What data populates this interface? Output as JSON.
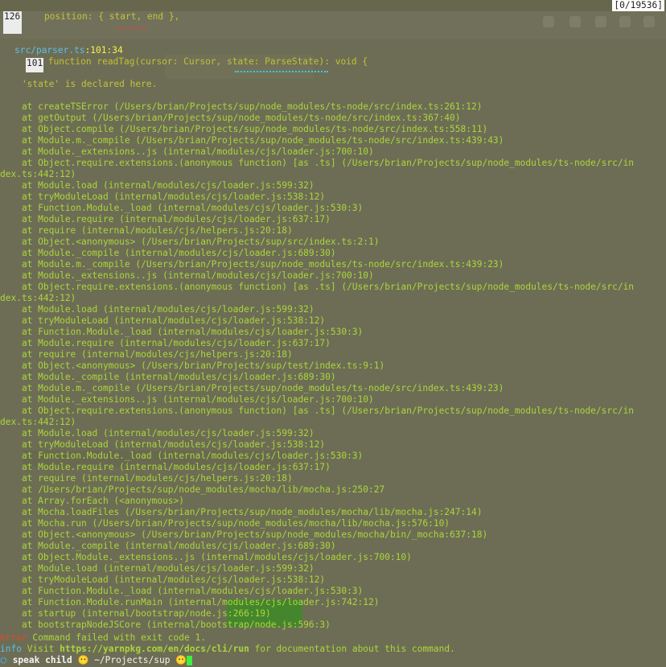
{
  "counter": "[0/19536]",
  "snippet": {
    "line1_num": "126",
    "line1_code": "    position: { start, end },",
    "file": "src/parser.ts",
    "file_pos": ":101:34",
    "line2_num": "101",
    "line2_code": " function readTag(cursor: Cursor, state: ParseState): void {",
    "note": "    'state' is declared here."
  },
  "trace": [
    "    at createTSError (/Users/brian/Projects/sup/node_modules/ts-node/src/index.ts:261:12)",
    "    at getOutput (/Users/brian/Projects/sup/node_modules/ts-node/src/index.ts:367:40)",
    "    at Object.compile (/Users/brian/Projects/sup/node_modules/ts-node/src/index.ts:558:11)",
    "    at Module.m._compile (/Users/brian/Projects/sup/node_modules/ts-node/src/index.ts:439:43)",
    "    at Module._extensions..js (internal/modules/cjs/loader.js:700:10)",
    "    at Object.require.extensions.(anonymous function) [as .ts] (/Users/brian/Projects/sup/node_modules/ts-node/src/in",
    "dex.ts:442:12)",
    "    at Module.load (internal/modules/cjs/loader.js:599:32)",
    "    at tryModuleLoad (internal/modules/cjs/loader.js:538:12)",
    "    at Function.Module._load (internal/modules/cjs/loader.js:530:3)",
    "    at Module.require (internal/modules/cjs/loader.js:637:17)",
    "    at require (internal/modules/cjs/helpers.js:20:18)",
    "    at Object.<anonymous> (/Users/brian/Projects/sup/src/index.ts:2:1)",
    "    at Module._compile (internal/modules/cjs/loader.js:689:30)",
    "    at Module.m._compile (/Users/brian/Projects/sup/node_modules/ts-node/src/index.ts:439:23)",
    "    at Module._extensions..js (internal/modules/cjs/loader.js:700:10)",
    "    at Object.require.extensions.(anonymous function) [as .ts] (/Users/brian/Projects/sup/node_modules/ts-node/src/in",
    "dex.ts:442:12)",
    "    at Module.load (internal/modules/cjs/loader.js:599:32)",
    "    at tryModuleLoad (internal/modules/cjs/loader.js:538:12)",
    "    at Function.Module._load (internal/modules/cjs/loader.js:530:3)",
    "    at Module.require (internal/modules/cjs/loader.js:637:17)",
    "    at require (internal/modules/cjs/helpers.js:20:18)",
    "    at Object.<anonymous> (/Users/brian/Projects/sup/test/index.ts:9:1)",
    "    at Module._compile (internal/modules/cjs/loader.js:689:30)",
    "    at Module.m._compile (/Users/brian/Projects/sup/node_modules/ts-node/src/index.ts:439:23)",
    "    at Module._extensions..js (internal/modules/cjs/loader.js:700:10)",
    "    at Object.require.extensions.(anonymous function) [as .ts] (/Users/brian/Projects/sup/node_modules/ts-node/src/in",
    "dex.ts:442:12)",
    "    at Module.load (internal/modules/cjs/loader.js:599:32)",
    "    at tryModuleLoad (internal/modules/cjs/loader.js:538:12)",
    "    at Function.Module._load (internal/modules/cjs/loader.js:530:3)",
    "    at Module.require (internal/modules/cjs/loader.js:637:17)",
    "    at require (internal/modules/cjs/helpers.js:20:18)",
    "    at /Users/brian/Projects/sup/node_modules/mocha/lib/mocha.js:250:27",
    "    at Array.forEach (<anonymous>)",
    "    at Mocha.loadFiles (/Users/brian/Projects/sup/node_modules/mocha/lib/mocha.js:247:14)",
    "    at Mocha.run (/Users/brian/Projects/sup/node_modules/mocha/lib/mocha.js:576:10)",
    "    at Object.<anonymous> (/Users/brian/Projects/sup/node_modules/mocha/bin/_mocha:637:18)",
    "    at Module._compile (internal/modules/cjs/loader.js:689:30)",
    "    at Object.Module._extensions..js (internal/modules/cjs/loader.js:700:10)",
    "    at Module.load (internal/modules/cjs/loader.js:599:32)",
    "    at tryModuleLoad (internal/modules/cjs/loader.js:538:12)",
    "    at Function.Module._load (internal/modules/cjs/loader.js:530:3)",
    "    at Function.Module.runMain (internal/modules/cjs/loader.js:742:12)",
    "    at startup (internal/bootstrap/node.js:266:19)",
    "    at bootstrapNodeJSCore (internal/bootstrap/node.js:596:3)"
  ],
  "error_line": {
    "tag": "error",
    "text": " Command failed with exit code 1."
  },
  "info_line": {
    "tag": "info",
    "pre": " Visit ",
    "url": "https://yarnpkg.com/en/docs/cli/run",
    "post": " for documentation about this command."
  },
  "prompt": {
    "icon": "terminal-prompt-icon",
    "name": " speak child ",
    "emoji1": "😶",
    "path": " ~/Projects/sup ",
    "emoji2": "😶"
  },
  "colors": {
    "trace_text": "#aad63a",
    "file_link": "#5abfe8",
    "error_tag": "#e0462e",
    "cursor": "#3ef03e"
  }
}
